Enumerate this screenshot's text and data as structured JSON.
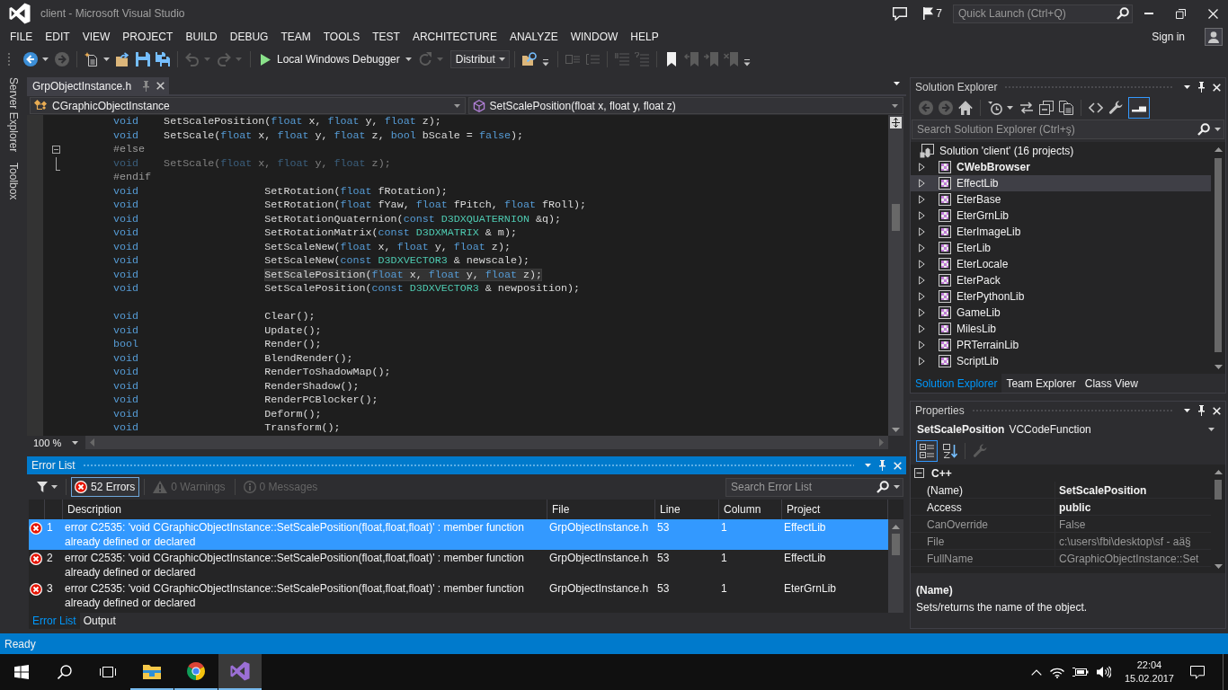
{
  "window": {
    "title": "client - Microsoft Visual Studio",
    "notifications": "7",
    "quick_launch": {
      "placeholder": "Quick Launch (Ctrl+Q)"
    },
    "sign_in": "Sign in"
  },
  "menu": [
    "FILE",
    "EDIT",
    "VIEW",
    "PROJECT",
    "BUILD",
    "DEBUG",
    "TEAM",
    "TOOLS",
    "TEST",
    "ARCHITECTURE",
    "ANALYZE",
    "WINDOW",
    "HELP"
  ],
  "toolbar": {
    "groups": [
      [
        {
          "kind": "back",
          "disabled": false,
          "dropdown": true
        },
        {
          "kind": "forward",
          "disabled": true,
          "dropdown": false
        }
      ],
      [
        {
          "kind": "new",
          "disabled": false,
          "dropdown": true
        },
        {
          "kind": "open",
          "disabled": false,
          "dropdown": false
        },
        {
          "kind": "save",
          "disabled": false,
          "dropdown": false
        },
        {
          "kind": "saveall",
          "disabled": false,
          "dropdown": false
        }
      ],
      [
        {
          "kind": "undo",
          "disabled": true,
          "dropdown": true
        },
        {
          "kind": "redo",
          "disabled": true,
          "dropdown": true
        }
      ],
      [
        {
          "kind": "start",
          "label": "Local Windows Debugger",
          "disabled": false,
          "dropdown": true
        },
        {
          "kind": "restart",
          "disabled": true,
          "dropdown": true
        },
        {
          "kind": "config",
          "label": "Distribut",
          "disabled": false,
          "dropdown": true
        }
      ],
      [
        {
          "kind": "find",
          "disabled": false,
          "dropdown": false
        },
        {
          "kind": "overflow",
          "disabled": false,
          "dropdown": false
        }
      ],
      [
        {
          "kind": "indent",
          "disabled": true,
          "dropdown": false
        },
        {
          "kind": "outdent",
          "disabled": true,
          "dropdown": false
        }
      ],
      [
        {
          "kind": "comment",
          "disabled": true,
          "dropdown": false
        },
        {
          "kind": "uncomment",
          "disabled": true,
          "dropdown": false
        }
      ],
      [
        {
          "kind": "bookmark",
          "disabled": false,
          "dropdown": false
        },
        {
          "kind": "bookprev",
          "disabled": true,
          "dropdown": false
        },
        {
          "kind": "booknext",
          "disabled": true,
          "dropdown": false
        },
        {
          "kind": "bookclear",
          "disabled": true,
          "dropdown": false
        },
        {
          "kind": "overflow",
          "disabled": false,
          "dropdown": false
        }
      ]
    ]
  },
  "side_tabs": [
    "Server Explorer",
    "Toolbox"
  ],
  "editor": {
    "tabs": [
      {
        "label": "GrpObjectInstance.h",
        "selected": true
      }
    ],
    "scope": "CGraphicObjectInstance",
    "member": "SetScalePosition(float x, float y, float z)",
    "blocks": [
      [
        {
          "tokens": [
            {
              "kind": "keyword",
              "text": "void"
            },
            {
              "kind": "plain",
              "text": "    SetScalePosition("
            },
            {
              "kind": "keyword",
              "text": "float"
            },
            {
              "kind": "plain",
              "text": " x, "
            },
            {
              "kind": "keyword",
              "text": "float"
            },
            {
              "kind": "plain",
              "text": " y, "
            },
            {
              "kind": "keyword",
              "text": "float"
            },
            {
              "kind": "plain",
              "text": " z);"
            }
          ],
          "inactive": false,
          "highlighted": false
        },
        {
          "tokens": [
            {
              "kind": "keyword",
              "text": "void"
            },
            {
              "kind": "plain",
              "text": "    SetScale("
            },
            {
              "kind": "keyword",
              "text": "float"
            },
            {
              "kind": "plain",
              "text": " x, "
            },
            {
              "kind": "keyword",
              "text": "float"
            },
            {
              "kind": "plain",
              "text": " y, "
            },
            {
              "kind": "keyword",
              "text": "float"
            },
            {
              "kind": "plain",
              "text": " z, "
            },
            {
              "kind": "keyword",
              "text": "bool"
            },
            {
              "kind": "plain",
              "text": " bScale = "
            },
            {
              "kind": "keyword",
              "text": "false"
            },
            {
              "kind": "plain",
              "text": ");"
            }
          ],
          "inactive": false,
          "highlighted": false
        },
        {
          "tokens": [
            {
              "kind": "preprocessor",
              "text": "#else"
            }
          ],
          "inactive": false,
          "highlighted": false,
          "fold": {
            "expanded": true
          }
        },
        {
          "tokens": [
            {
              "kind": "keyword",
              "text": "void"
            },
            {
              "kind": "plain",
              "text": "    SetScale("
            },
            {
              "kind": "keyword",
              "text": "float"
            },
            {
              "kind": "plain",
              "text": " x, "
            },
            {
              "kind": "keyword",
              "text": "float"
            },
            {
              "kind": "plain",
              "text": " y, "
            },
            {
              "kind": "keyword",
              "text": "float"
            },
            {
              "kind": "plain",
              "text": " z);"
            }
          ],
          "inactive": true,
          "highlighted": false
        },
        {
          "tokens": [
            {
              "kind": "preprocessor",
              "text": "#endif"
            }
          ],
          "inactive": false,
          "highlighted": false
        },
        {
          "tokens": [
            {
              "kind": "keyword",
              "text": "void"
            },
            {
              "kind": "plain",
              "text": "                    SetRotation("
            },
            {
              "kind": "keyword",
              "text": "float"
            },
            {
              "kind": "plain",
              "text": " fRotation);"
            }
          ],
          "inactive": false,
          "highlighted": false
        },
        {
          "tokens": [
            {
              "kind": "keyword",
              "text": "void"
            },
            {
              "kind": "plain",
              "text": "                    SetRotation("
            },
            {
              "kind": "keyword",
              "text": "float"
            },
            {
              "kind": "plain",
              "text": " fYaw, "
            },
            {
              "kind": "keyword",
              "text": "float"
            },
            {
              "kind": "plain",
              "text": " fPitch, "
            },
            {
              "kind": "keyword",
              "text": "float"
            },
            {
              "kind": "plain",
              "text": " fRoll);"
            }
          ],
          "inactive": false,
          "highlighted": false
        },
        {
          "tokens": [
            {
              "kind": "keyword",
              "text": "void"
            },
            {
              "kind": "plain",
              "text": "                    SetRotationQuaternion("
            },
            {
              "kind": "keyword",
              "text": "const"
            },
            {
              "kind": "type",
              "text": " D3DXQUATERNION"
            },
            {
              "kind": "plain",
              "text": " &q);"
            }
          ],
          "inactive": false,
          "highlighted": false
        },
        {
          "tokens": [
            {
              "kind": "keyword",
              "text": "void"
            },
            {
              "kind": "plain",
              "text": "                    SetRotationMatrix("
            },
            {
              "kind": "keyword",
              "text": "const"
            },
            {
              "kind": "type",
              "text": " D3DXMATRIX"
            },
            {
              "kind": "plain",
              "text": " & m);"
            }
          ],
          "inactive": false,
          "highlighted": false
        },
        {
          "tokens": [
            {
              "kind": "keyword",
              "text": "void"
            },
            {
              "kind": "plain",
              "text": "                    SetScaleNew("
            },
            {
              "kind": "keyword",
              "text": "float"
            },
            {
              "kind": "plain",
              "text": " x, "
            },
            {
              "kind": "keyword",
              "text": "float"
            },
            {
              "kind": "plain",
              "text": " y, "
            },
            {
              "kind": "keyword",
              "text": "float"
            },
            {
              "kind": "plain",
              "text": " z);"
            }
          ],
          "inactive": false,
          "highlighted": false
        },
        {
          "tokens": [
            {
              "kind": "keyword",
              "text": "void"
            },
            {
              "kind": "plain",
              "text": "                    SetScaleNew("
            },
            {
              "kind": "keyword",
              "text": "const"
            },
            {
              "kind": "type",
              "text": " D3DXVECTOR3"
            },
            {
              "kind": "plain",
              "text": " & newscale);"
            }
          ],
          "inactive": false,
          "highlighted": false
        },
        {
          "tokens": [
            {
              "kind": "keyword",
              "text": "void"
            },
            {
              "kind": "plain",
              "text": "                    SetScalePosition("
            },
            {
              "kind": "keyword",
              "text": "float"
            },
            {
              "kind": "plain",
              "text": " x, "
            },
            {
              "kind": "keyword",
              "text": "float"
            },
            {
              "kind": "plain",
              "text": " y, "
            },
            {
              "kind": "keyword",
              "text": "float"
            },
            {
              "kind": "plain",
              "text": " z);"
            }
          ],
          "inactive": false,
          "highlighted": true
        },
        {
          "tokens": [
            {
              "kind": "keyword",
              "text": "void"
            },
            {
              "kind": "plain",
              "text": "                    SetScalePosition("
            },
            {
              "kind": "keyword",
              "text": "const"
            },
            {
              "kind": "type",
              "text": " D3DXVECTOR3"
            },
            {
              "kind": "plain",
              "text": " & newposition);"
            }
          ],
          "inactive": false,
          "highlighted": false
        }
      ],
      [
        {
          "tokens": [
            {
              "kind": "keyword",
              "text": "void"
            },
            {
              "kind": "plain",
              "text": "                    Clear();"
            }
          ],
          "inactive": false,
          "highlighted": false
        },
        {
          "tokens": [
            {
              "kind": "keyword",
              "text": "void"
            },
            {
              "kind": "plain",
              "text": "                    Update();"
            }
          ],
          "inactive": false,
          "highlighted": false
        },
        {
          "tokens": [
            {
              "kind": "keyword",
              "text": "bool"
            },
            {
              "kind": "plain",
              "text": "                    Render();"
            }
          ],
          "inactive": false,
          "highlighted": false
        },
        {
          "tokens": [
            {
              "kind": "keyword",
              "text": "void"
            },
            {
              "kind": "plain",
              "text": "                    BlendRender();"
            }
          ],
          "inactive": false,
          "highlighted": false
        },
        {
          "tokens": [
            {
              "kind": "keyword",
              "text": "void"
            },
            {
              "kind": "plain",
              "text": "                    RenderToShadowMap();"
            }
          ],
          "inactive": false,
          "highlighted": false
        },
        {
          "tokens": [
            {
              "kind": "keyword",
              "text": "void"
            },
            {
              "kind": "plain",
              "text": "                    RenderShadow();"
            }
          ],
          "inactive": false,
          "highlighted": false
        },
        {
          "tokens": [
            {
              "kind": "keyword",
              "text": "void"
            },
            {
              "kind": "plain",
              "text": "                    RenderPCBlocker();"
            }
          ],
          "inactive": false,
          "highlighted": false
        },
        {
          "tokens": [
            {
              "kind": "keyword",
              "text": "void"
            },
            {
              "kind": "plain",
              "text": "                    Deform();"
            }
          ],
          "inactive": false,
          "highlighted": false
        },
        {
          "tokens": [
            {
              "kind": "keyword",
              "text": "void"
            },
            {
              "kind": "plain",
              "text": "                    Transform();"
            }
          ],
          "inactive": false,
          "highlighted": false
        }
      ]
    ],
    "zoom": "100 %"
  },
  "error_list": {
    "title": "Error List",
    "filters": [
      {
        "kind": "error",
        "label": "52 Errors",
        "selected": true,
        "disabled": false
      },
      {
        "kind": "warning",
        "label": "0 Warnings",
        "selected": false,
        "disabled": true
      },
      {
        "kind": "message",
        "label": "0 Messages",
        "selected": false,
        "disabled": true
      }
    ],
    "search": {
      "placeholder": "Search Error List"
    },
    "columns": [
      "Description",
      "File",
      "Line",
      "Column",
      "Project"
    ],
    "rows": [
      {
        "number": "1",
        "description": "error C2535: 'void CGraphicObjectInstance::SetScalePosition(float,float,float)' : member function already defined or declared",
        "file": "GrpObjectInstance.h",
        "line": "53",
        "column": "1",
        "project": "EffectLib",
        "selected": true
      },
      {
        "number": "2",
        "description": "error C2535: 'void CGraphicObjectInstance::SetScalePosition(float,float,float)' : member function already defined or declared",
        "file": "GrpObjectInstance.h",
        "line": "53",
        "column": "1",
        "project": "EffectLib",
        "selected": false
      },
      {
        "number": "3",
        "description": "error C2535: 'void CGraphicObjectInstance::SetScalePosition(float,float,float)' : member function already defined or declared",
        "file": "GrpObjectInstance.h",
        "line": "53",
        "column": "1",
        "project": "EterGrnLib",
        "selected": false
      }
    ],
    "tabs": [
      {
        "label": "Error List",
        "selected": true
      },
      {
        "label": "Output",
        "selected": false
      }
    ]
  },
  "solution_explorer": {
    "title": "Solution Explorer",
    "toolbar": [
      [
        {
          "kind": "back",
          "disabled": true,
          "selected": false,
          "dropdown": false
        },
        {
          "kind": "forward",
          "disabled": true,
          "selected": false,
          "dropdown": false
        },
        {
          "kind": "home",
          "disabled": false,
          "selected": false,
          "dropdown": false
        }
      ],
      [
        {
          "kind": "sync",
          "disabled": false,
          "selected": false,
          "dropdown": true
        },
        {
          "kind": "swap",
          "disabled": false,
          "selected": false,
          "dropdown": false
        },
        {
          "kind": "collapse",
          "disabled": false,
          "selected": false,
          "dropdown": false
        },
        {
          "kind": "showall",
          "disabled": false,
          "selected": false,
          "dropdown": false
        }
      ],
      [
        {
          "kind": "code",
          "disabled": false,
          "selected": false,
          "dropdown": false
        },
        {
          "kind": "wrench",
          "disabled": false,
          "selected": false,
          "dropdown": false
        },
        {
          "kind": "preview",
          "disabled": false,
          "selected": true,
          "dropdown": false
        }
      ]
    ],
    "search": {
      "placeholder": "Search Solution Explorer (Ctrl+ş)"
    },
    "tree": {
      "label": "Solution 'client' (16 projects)",
      "selected": false,
      "children": [
        {
          "label": "CWebBrowser",
          "startup": true,
          "expanded": false,
          "selected": false
        },
        {
          "label": "EffectLib",
          "startup": false,
          "expanded": false,
          "selected": true
        },
        {
          "label": "EterBase",
          "startup": false,
          "expanded": false,
          "selected": false
        },
        {
          "label": "EterGrnLib",
          "startup": false,
          "expanded": false,
          "selected": false
        },
        {
          "label": "EterImageLib",
          "startup": false,
          "expanded": false,
          "selected": false
        },
        {
          "label": "EterLib",
          "startup": false,
          "expanded": false,
          "selected": false
        },
        {
          "label": "EterLocale",
          "startup": false,
          "expanded": false,
          "selected": false
        },
        {
          "label": "EterPack",
          "startup": false,
          "expanded": false,
          "selected": false
        },
        {
          "label": "EterPythonLib",
          "startup": false,
          "expanded": false,
          "selected": false
        },
        {
          "label": "GameLib",
          "startup": false,
          "expanded": false,
          "selected": false
        },
        {
          "label": "MilesLib",
          "startup": false,
          "expanded": false,
          "selected": false
        },
        {
          "label": "PRTerrainLib",
          "startup": false,
          "expanded": false,
          "selected": false
        },
        {
          "label": "ScriptLib",
          "startup": false,
          "expanded": false,
          "selected": false
        }
      ]
    },
    "tabs": [
      {
        "label": "Solution Explorer",
        "selected": true
      },
      {
        "label": "Team Explorer",
        "selected": false
      },
      {
        "label": "Class View",
        "selected": false
      }
    ]
  },
  "properties": {
    "title": "Properties",
    "object_name": "SetScalePosition",
    "object_type": "VCCodeFunction",
    "toolbar": [
      [
        {
          "kind": "categorized",
          "disabled": false,
          "selected": true,
          "dropdown": false
        },
        {
          "kind": "alphabetical",
          "disabled": false,
          "selected": false,
          "dropdown": false
        }
      ],
      [
        {
          "kind": "pages",
          "disabled": true,
          "selected": false,
          "dropdown": false
        }
      ]
    ],
    "category": {
      "label": "C++",
      "expanded": true
    },
    "rows": [
      {
        "name": "(Name)",
        "value": "SetScalePosition",
        "readonly": false
      },
      {
        "name": "Access",
        "value": "public",
        "readonly": false
      },
      {
        "name": "CanOverride",
        "value": "False",
        "readonly": true
      },
      {
        "name": "File",
        "value": "c:\\users\\fbi\\desktop\\sf - aä§",
        "readonly": true
      },
      {
        "name": "FullName",
        "value": "CGraphicObjectInstance::Set",
        "readonly": true
      }
    ],
    "description": {
      "title": "(Name)",
      "text": "Sets/returns the name of the object."
    }
  },
  "status_bar": "Ready",
  "taskbar": {
    "apps": [
      {
        "kind": "explorer",
        "open": true,
        "selected": false
      },
      {
        "kind": "browser",
        "open": true,
        "selected": false
      },
      {
        "kind": "studio",
        "open": true,
        "selected": true
      }
    ],
    "time": "22:04",
    "date": "15.02.2017"
  }
}
